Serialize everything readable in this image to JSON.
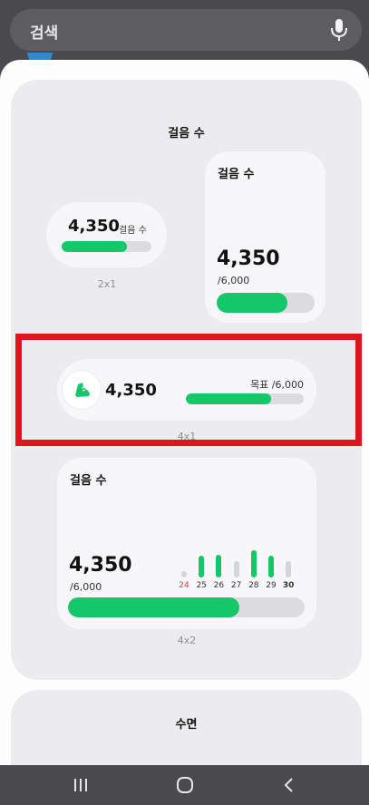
{
  "search": {
    "label": "검색"
  },
  "group": {
    "title": "걸음 수",
    "steps": "4,350",
    "goal": "/6,000",
    "progress_fraction": 0.725
  },
  "widget_2x1": {
    "steps": "4,350",
    "unit": "걸음 수",
    "caption": "2x1"
  },
  "widget_2x2": {
    "title": "걸음 수",
    "steps": "4,350",
    "goal": "/6,000"
  },
  "widget_4x1": {
    "steps": "4,350",
    "goal_label": "목표 /6,000",
    "caption": "4x1"
  },
  "widget_4x2": {
    "title": "걸음 수",
    "steps": "4,350",
    "goal": "/6,000",
    "caption": "4x2",
    "days": [
      "24",
      "25",
      "26",
      "27",
      "28",
      "29",
      "30"
    ]
  },
  "chart_data": {
    "type": "bar",
    "categories": [
      "24",
      "25",
      "26",
      "27",
      "28",
      "29",
      "30"
    ],
    "values": [
      0.25,
      0.8,
      0.85,
      0.6,
      1.0,
      0.8,
      0.6
    ],
    "active": [
      false,
      true,
      true,
      false,
      true,
      true,
      false
    ]
  },
  "sleep": {
    "title": "수면"
  },
  "colors": {
    "green": "#14c86a",
    "track": "#dcdcdf",
    "inactive": "#d6d6d9",
    "sunday": "#e23c3c",
    "highlight": "#e0141c"
  }
}
